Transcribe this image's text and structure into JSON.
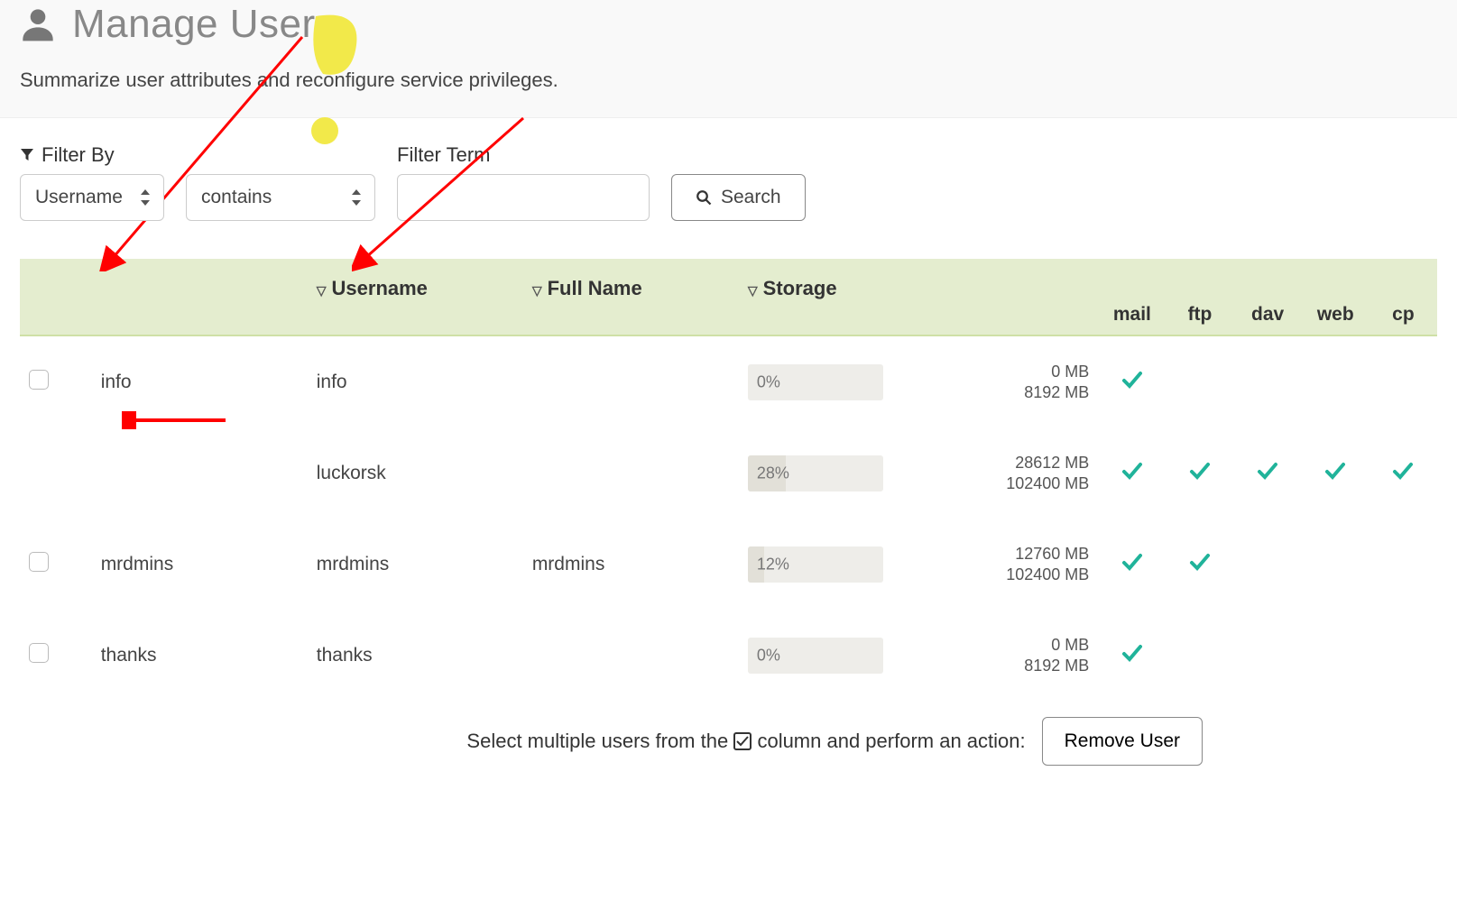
{
  "header": {
    "title": "Manage Users",
    "subtitle": "Summarize user attributes and reconfigure service privileges."
  },
  "filter": {
    "label": "Filter By",
    "field_select": "Username",
    "op_select": "contains",
    "term_label": "Filter Term",
    "term_value": "",
    "search_label": "Search"
  },
  "columns": {
    "username": "Username",
    "fullname": "Full Name",
    "storage": "Storage",
    "services": [
      "mail",
      "ftp",
      "dav",
      "web",
      "cp"
    ]
  },
  "rows": [
    {
      "checkbox": true,
      "name": "info",
      "username": "info",
      "fullname": "",
      "pct_text": "0%",
      "pct_fill": 0,
      "used": "0 MB",
      "total": "8192 MB",
      "svc": {
        "mail": true,
        "ftp": false,
        "dav": false,
        "web": false,
        "cp": false
      }
    },
    {
      "checkbox": false,
      "name": "",
      "username": "luckorsk",
      "fullname": "",
      "pct_text": "28%",
      "pct_fill": 28,
      "used": "28612 MB",
      "total": "102400 MB",
      "svc": {
        "mail": true,
        "ftp": true,
        "dav": true,
        "web": true,
        "cp": true
      }
    },
    {
      "checkbox": true,
      "name": "mrdmins",
      "username": "mrdmins",
      "fullname": "mrdmins",
      "pct_text": "12%",
      "pct_fill": 12,
      "used": "12760 MB",
      "total": "102400 MB",
      "svc": {
        "mail": true,
        "ftp": true,
        "dav": false,
        "web": false,
        "cp": false
      }
    },
    {
      "checkbox": true,
      "name": "thanks",
      "username": "thanks",
      "fullname": "",
      "pct_text": "0%",
      "pct_fill": 0,
      "used": "0 MB",
      "total": "8192 MB",
      "svc": {
        "mail": true,
        "ftp": false,
        "dav": false,
        "web": false,
        "cp": false
      }
    }
  ],
  "footer": {
    "text_pre": "Select multiple users from the ",
    "text_post": " column and perform an action:",
    "remove_label": "Remove User"
  },
  "colors": {
    "accent": "#20b39a",
    "header_bg": "#e4edcf"
  }
}
